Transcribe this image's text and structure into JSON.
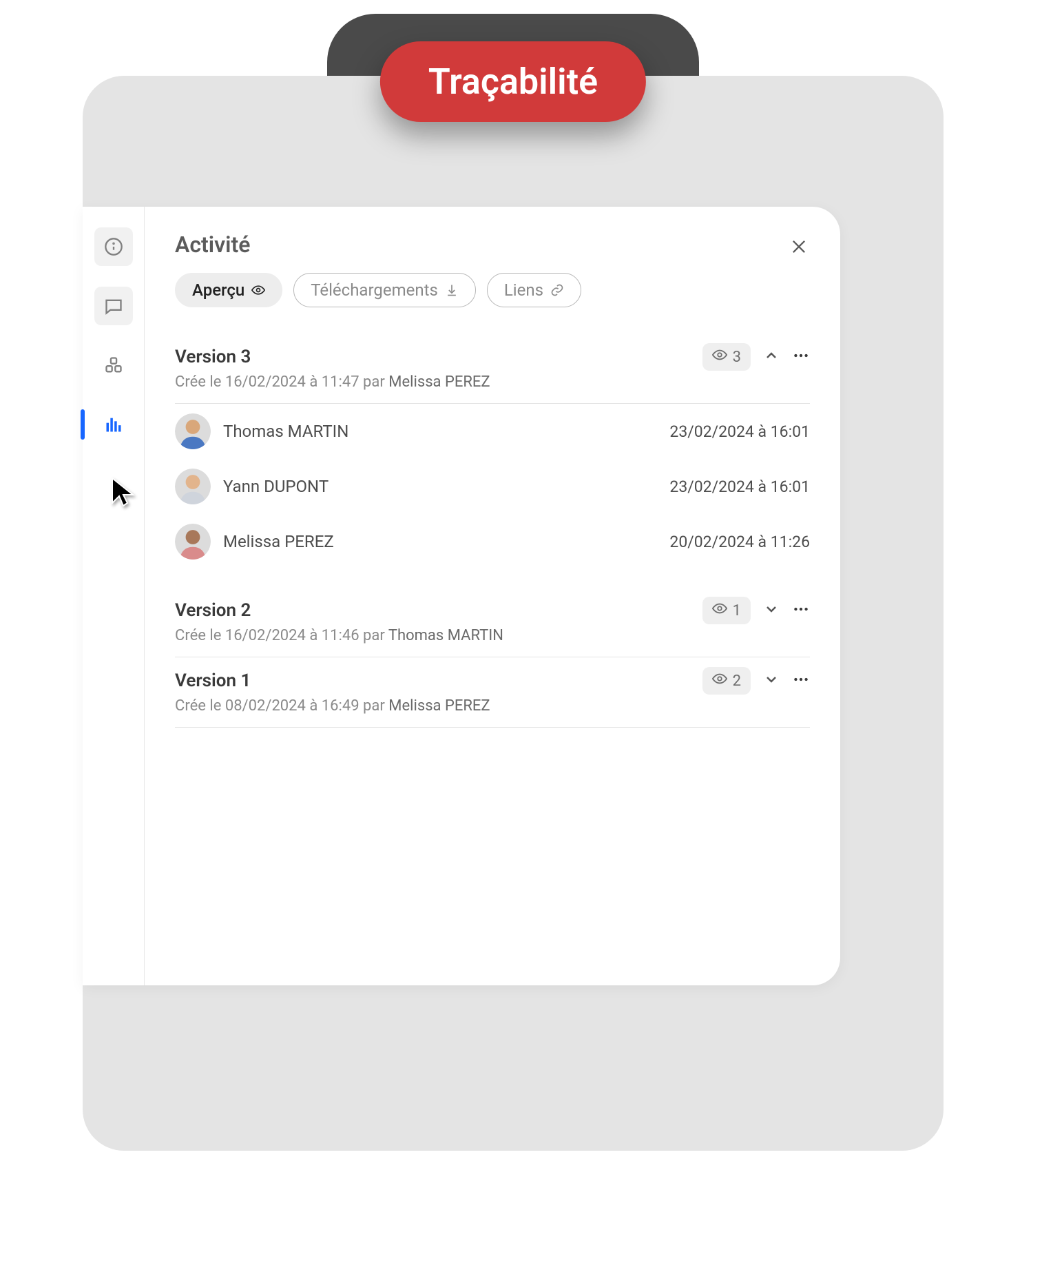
{
  "header": {
    "pill_label": "Traçabilité"
  },
  "panel": {
    "title": "Activité",
    "tabs": {
      "apercu": "Aperçu",
      "telechargements": "Téléchargements",
      "liens": "Liens"
    }
  },
  "versions": [
    {
      "title": "Version 3",
      "created_prefix": "Crée le 16/02/2024 à 11:47 par",
      "author": "Melissa PEREZ",
      "view_count": "3",
      "expanded": true,
      "viewers": [
        {
          "name": "Thomas MARTIN",
          "date": "23/02/2024 à 16:01",
          "avatar": {
            "skin": "#d9a77a",
            "shirt": "#4a78c2"
          }
        },
        {
          "name": "Yann DUPONT",
          "date": "23/02/2024 à 16:01",
          "avatar": {
            "skin": "#e2b48c",
            "shirt": "#cfd4dc"
          }
        },
        {
          "name": "Melissa PEREZ",
          "date": "20/02/2024 à 11:26",
          "avatar": {
            "skin": "#a8785a",
            "shirt": "#d98b8b"
          }
        }
      ]
    },
    {
      "title": "Version 2",
      "created_prefix": "Crée le 16/02/2024 à 11:46 par",
      "author": "Thomas MARTIN",
      "view_count": "1",
      "expanded": false
    },
    {
      "title": "Version 1",
      "created_prefix": "Crée le 08/02/2024 à 16:49 par",
      "author": "Melissa PEREZ",
      "view_count": "2",
      "expanded": false
    }
  ]
}
